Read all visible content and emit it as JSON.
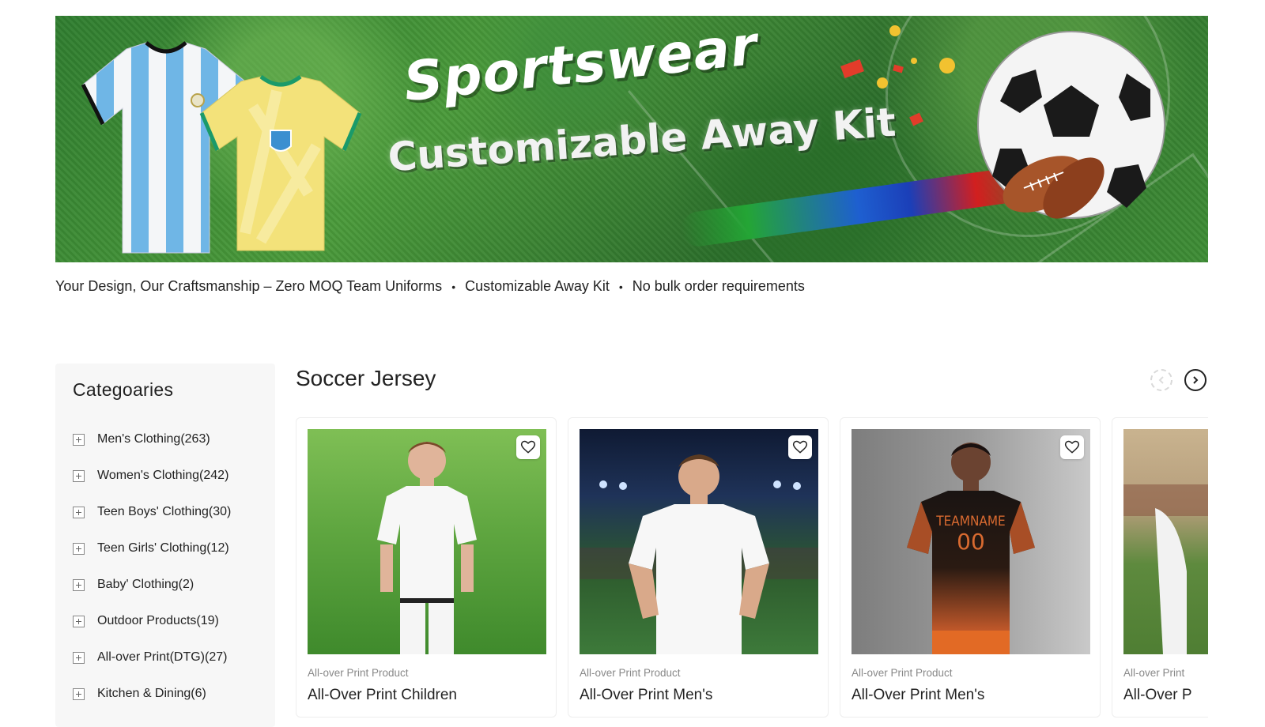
{
  "hero": {
    "title": "Sportswear",
    "subtitle": "Customizable Away Kit"
  },
  "tagline": {
    "items": [
      "Your Design, Our Craftsmanship – Zero MOQ Team Uniforms",
      "Customizable Away Kit",
      "No bulk order requirements"
    ],
    "separator": "•"
  },
  "sidebar": {
    "title": "Categoaries",
    "items": [
      {
        "label": "Men's Clothing(263)"
      },
      {
        "label": "Women's Clothing(242)"
      },
      {
        "label": "Teen Boys' Clothing(30)"
      },
      {
        "label": "Teen Girls' Clothing(12)"
      },
      {
        "label": "Baby' Clothing(2)"
      },
      {
        "label": "Outdoor Products(19)"
      },
      {
        "label": "All-over Print(DTG)(27)"
      },
      {
        "label": "Kitchen & Dining(6)"
      }
    ]
  },
  "section": {
    "title": "Soccer Jersey"
  },
  "products": [
    {
      "category": "All-over Print Product",
      "name": "All-Over Print Children"
    },
    {
      "category": "All-over Print Product",
      "name": "All-Over Print Men's"
    },
    {
      "category": "All-over Print Product",
      "name": "All-Over Print Men's"
    },
    {
      "category": "All-over Print",
      "name": "All-Over P"
    }
  ],
  "jersey_print": {
    "team": "TEAMNAME",
    "number": "00"
  },
  "icons": {
    "wishlist": "heart-icon",
    "next": "chevron-right-icon",
    "prev": "chevron-left-icon",
    "expand": "plus-icon"
  },
  "colors": {
    "accent": "#222222",
    "muted_text": "#888888",
    "sidebar_bg": "#f7f7f7"
  }
}
